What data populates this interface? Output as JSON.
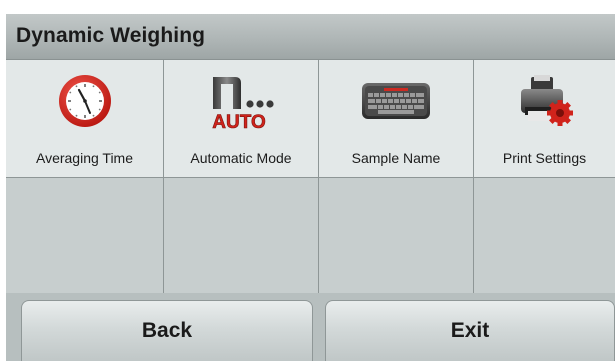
{
  "header": {
    "title": "Dynamic Weighing"
  },
  "menu": {
    "items": [
      {
        "label": "Averaging Time",
        "icon": "clock-icon"
      },
      {
        "label": "Automatic Mode",
        "icon": "auto-mode-icon",
        "icon_text": "AUTO"
      },
      {
        "label": "Sample Name",
        "icon": "keyboard-icon"
      },
      {
        "label": "Print Settings",
        "icon": "printer-settings-icon"
      }
    ]
  },
  "footer": {
    "back_label": "Back",
    "exit_label": "Exit"
  },
  "colors": {
    "accent_red": "#cc2a22"
  }
}
